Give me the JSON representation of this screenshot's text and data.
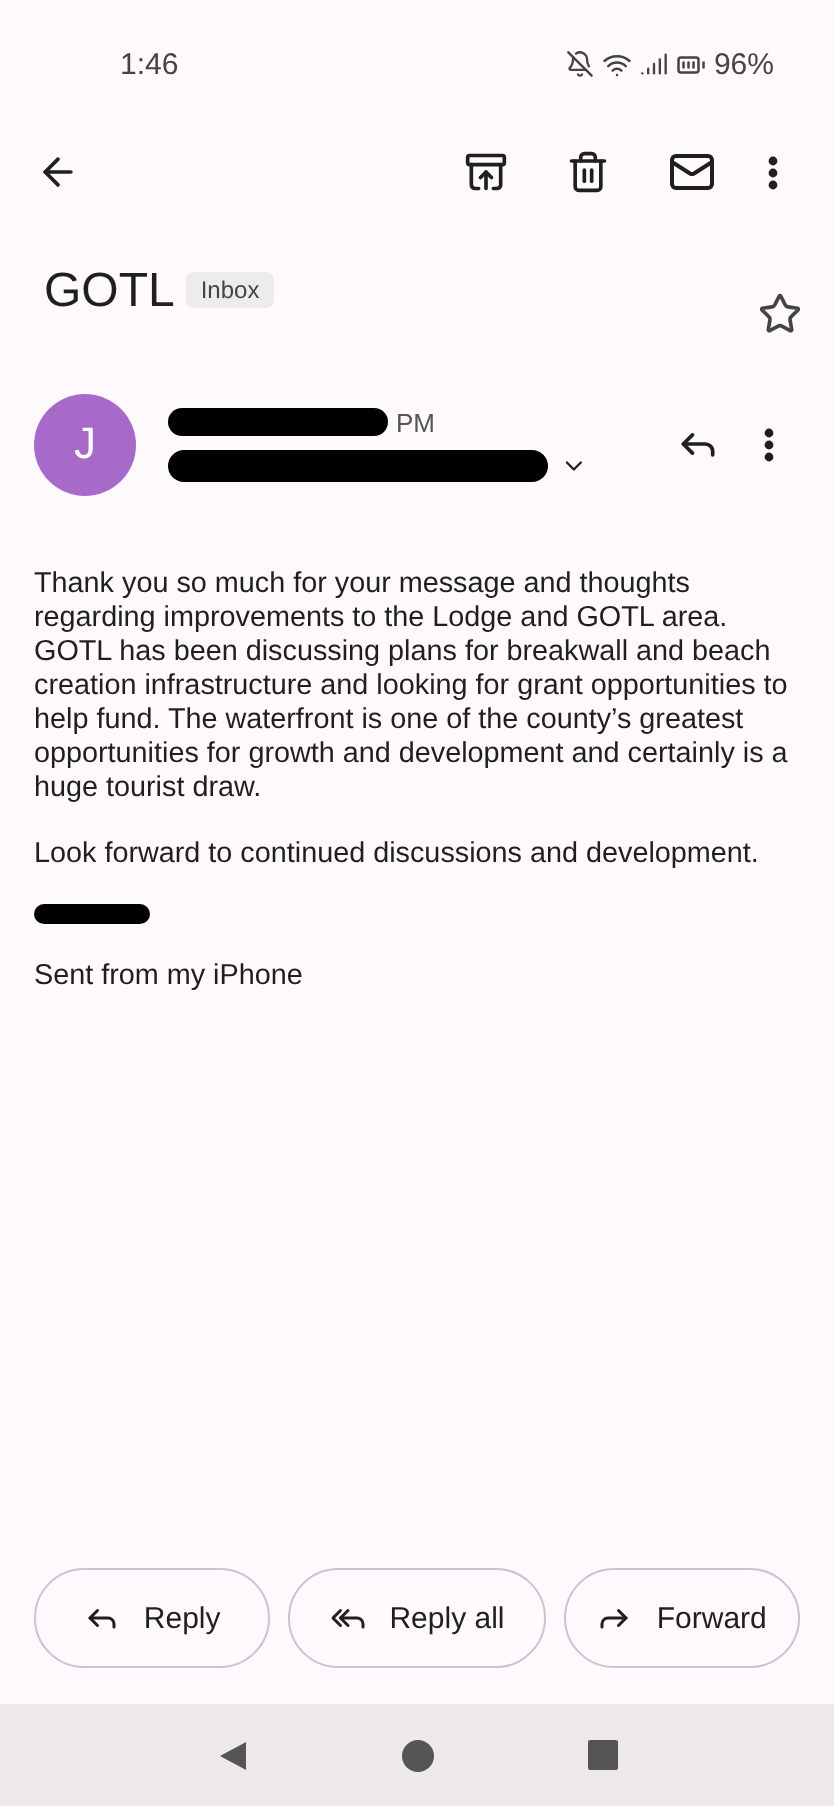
{
  "status_bar": {
    "time": "1:46",
    "battery": "96%"
  },
  "subject": {
    "title": "GOTL",
    "label": "Inbox",
    "starred": false
  },
  "message": {
    "avatar_letter": "J",
    "time": "PM",
    "body": [
      "Thank you so much for your message and thoughts regarding improvements to the Lodge and GOTL area. GOTL has been discussing plans for breakwall and beach creation infrastructure and looking for grant opportunities to help fund. The waterfront is one of the county’s greatest opportunities for growth and development and certainly is a huge tourist draw.",
      "Look forward to continued discussions and development."
    ],
    "signature": "Sent from my iPhone"
  },
  "actions": [
    {
      "kind": "reply",
      "label": "Reply"
    },
    {
      "kind": "reply_all",
      "label": "Reply all"
    },
    {
      "kind": "forward",
      "label": "Forward"
    }
  ]
}
